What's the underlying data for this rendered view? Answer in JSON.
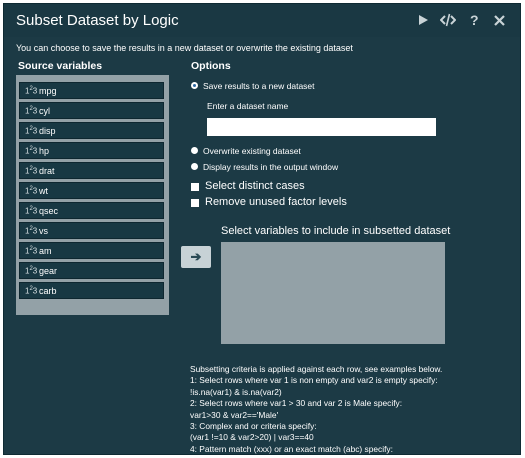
{
  "window": {
    "title": "Subset Dataset by Logic",
    "icons": [
      "run-icon",
      "code-icon",
      "help-icon",
      "close-icon"
    ]
  },
  "subtitle": "You can choose to save the results in a new dataset or overwrite the existing dataset",
  "source": {
    "label": "Source variables",
    "items": [
      {
        "icon": "1₂3",
        "name": "mpg"
      },
      {
        "icon": "1₂3",
        "name": "cyl"
      },
      {
        "icon": "1₂3",
        "name": "disp"
      },
      {
        "icon": "1₂3",
        "name": "hp"
      },
      {
        "icon": "1₂3",
        "name": "drat"
      },
      {
        "icon": "1₂3",
        "name": "wt"
      },
      {
        "icon": "1₂3",
        "name": "qsec"
      },
      {
        "icon": "1₂3",
        "name": "vs"
      },
      {
        "icon": "1₂3",
        "name": "am"
      },
      {
        "icon": "1₂3",
        "name": "gear"
      },
      {
        "icon": "1₂3",
        "name": "carb"
      }
    ]
  },
  "options": {
    "label": "Options",
    "save_new": "Save results to a new dataset",
    "dataset_name_label": "Enter a dataset name",
    "dataset_name_value": "",
    "overwrite": "Overwrite existing dataset",
    "display": "Display results in the output window",
    "distinct": "Select distinct cases",
    "remove_unused": "Remove unused factor levels"
  },
  "target": {
    "label": "Select variables to include in subsetted dataset",
    "move_button": "➔"
  },
  "help": [
    "Subsetting criteria is applied against each row, see examples below.",
    "1: Select rows where var 1 is non empty and var2 is empty specify:",
    "!is.na(var1) & is.na(var2)",
    "2: Select rows where var1 > 30 and var 2 is Male specify:",
    "var1>30 & var2=='Male'",
    "3: Complex and or criteria specify:",
    "(var1 !=10 & var2>20) | var3==40",
    "4: Pattern match (xxx) or an exact match (abc) specify:"
  ]
}
